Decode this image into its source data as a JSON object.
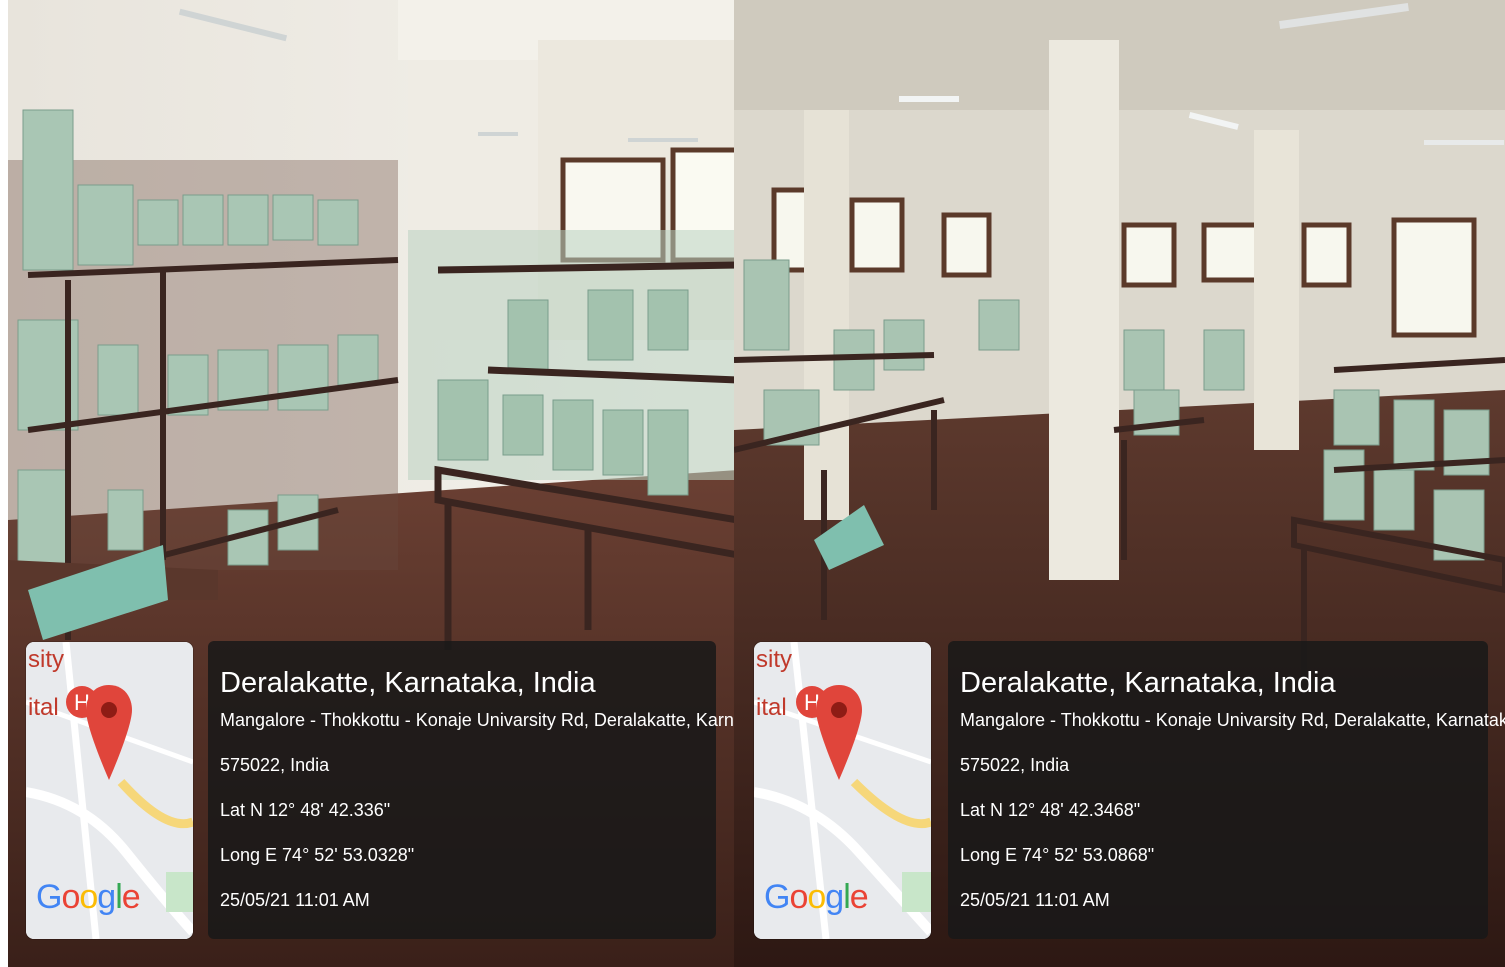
{
  "panels": [
    {
      "location_title": "Deralakatte, Karnataka, India",
      "address_line1": "Mangalore - Thokkottu - Konaje Univarsity Rd, Deralakatte, Karnataka",
      "address_line2": "575022, India",
      "latitude": "Lat N 12° 48' 42.336\"",
      "longitude": "Long E 74° 52' 53.0328\"",
      "timestamp": "25/05/21 11:01 AM",
      "map_label_top": "sity",
      "map_label_bottom": "ital",
      "map_pin_letter": "H",
      "map_brand": "Google"
    },
    {
      "location_title": "Deralakatte, Karnataka, India",
      "address_line1": "Mangalore - Thokkottu - Konaje Univarsity Rd, Deralakatte, Karnataka",
      "address_line2": "575022, India",
      "latitude": "Lat N 12° 48' 42.3468\"",
      "longitude": "Long E 74° 52' 53.0868\"",
      "timestamp": "25/05/21 11:01 AM",
      "map_label_top": "sity",
      "map_label_bottom": "ital",
      "map_pin_letter": "H",
      "map_brand": "Google"
    }
  ],
  "colors": {
    "pin_red": "#e0453b",
    "card_bg": "#191919",
    "floor_brown": "#4a2b22"
  }
}
